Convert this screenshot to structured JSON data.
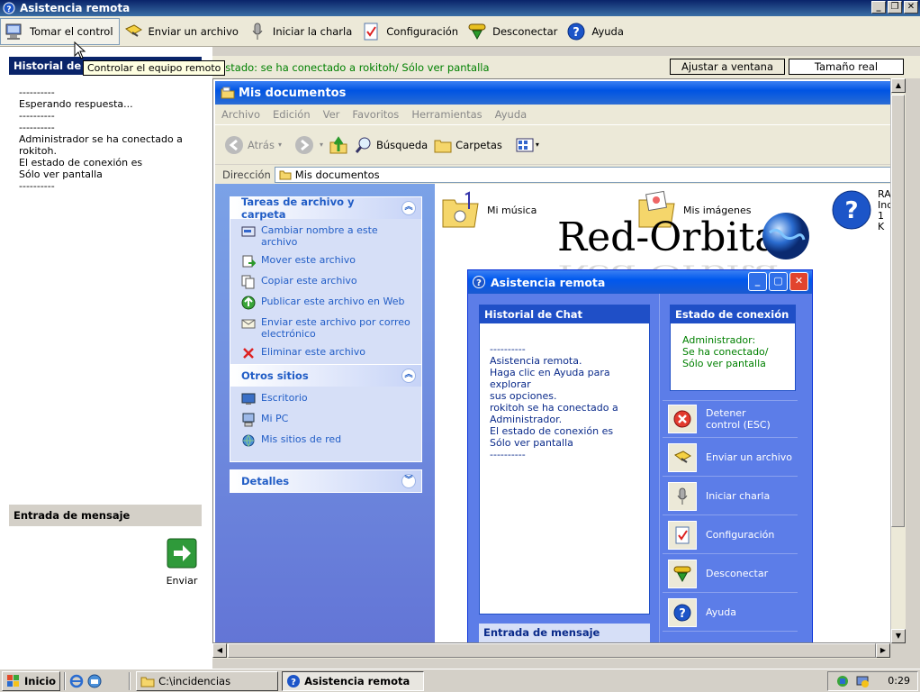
{
  "window": {
    "title": "Asistencia remota"
  },
  "toolbar": {
    "take_control": "Tomar el control",
    "send_file": "Enviar un archivo",
    "start_chat": "Iniciar la charla",
    "settings": "Configuración",
    "disconnect": "Desconectar",
    "help": "Ayuda"
  },
  "tooltip": "Controlar el equipo remoto",
  "left": {
    "chat_header": "Historial de Chat",
    "chat_lines": [
      "----------",
      "Esperando respuesta...",
      "----------",
      "----------",
      "Administrador se ha conectado a",
      "rokitoh.",
      "El estado de conexión es",
      "Sólo ver pantalla",
      "----------"
    ],
    "message_header": "Entrada de mensaje",
    "send_label": "Enviar"
  },
  "status": {
    "text": "Estado: se ha conectado a rokitoh/ Sólo ver pantalla",
    "fit_button": "Ajustar a ventana",
    "actual_size_button": "Tamaño real"
  },
  "explorer": {
    "title": "Mis documentos",
    "menu": [
      "Archivo",
      "Edición",
      "Ver",
      "Favoritos",
      "Herramientas",
      "Ayuda"
    ],
    "back": "Atrás",
    "search": "Búsqueda",
    "folders": "Carpetas",
    "address_label": "Dirección",
    "address_value": "Mis documentos",
    "file_tasks_header": "Tareas de archivo y carpeta",
    "file_tasks": [
      "Cambiar nombre a este archivo",
      "Mover este archivo",
      "Copiar este archivo",
      "Publicar este archivo en Web",
      "Enviar este archivo por correo electrónico",
      "Eliminar este archivo"
    ],
    "other_places_header": "Otros sitios",
    "other_places": [
      "Escritorio",
      "Mi PC",
      "Mis sitios de red"
    ],
    "details_header": "Detalles",
    "files": [
      "Mi música",
      "Mis imágenes"
    ],
    "partial_file": [
      "RA",
      "Inc",
      "1 K"
    ]
  },
  "logo": "Red-Orbita",
  "inner": {
    "title": "Asistencia remota",
    "chat_header": "Historial de Chat",
    "chat_lines": [
      "----------",
      "Asistencia remota.",
      "Haga clic en Ayuda para explorar",
      "sus opciones.",
      "rokitoh se ha conectado a",
      "Administrador.",
      "El estado de conexión es",
      "Sólo ver pantalla",
      "----------"
    ],
    "message_header": "Entrada de mensaje",
    "status_header": "Estado de conexión",
    "status_lines": [
      "Administrador:",
      "Se ha conectado/",
      "Sólo ver pantalla"
    ],
    "buttons": [
      "Detener control (ESC)",
      "Enviar un archivo",
      "Iniciar charla",
      "Configuración",
      "Desconectar",
      "Ayuda"
    ]
  },
  "taskbar": {
    "start": "Inicio",
    "folder_item": "C:\\incidencias",
    "app_item": "Asistencia remota",
    "clock": "0:29"
  }
}
